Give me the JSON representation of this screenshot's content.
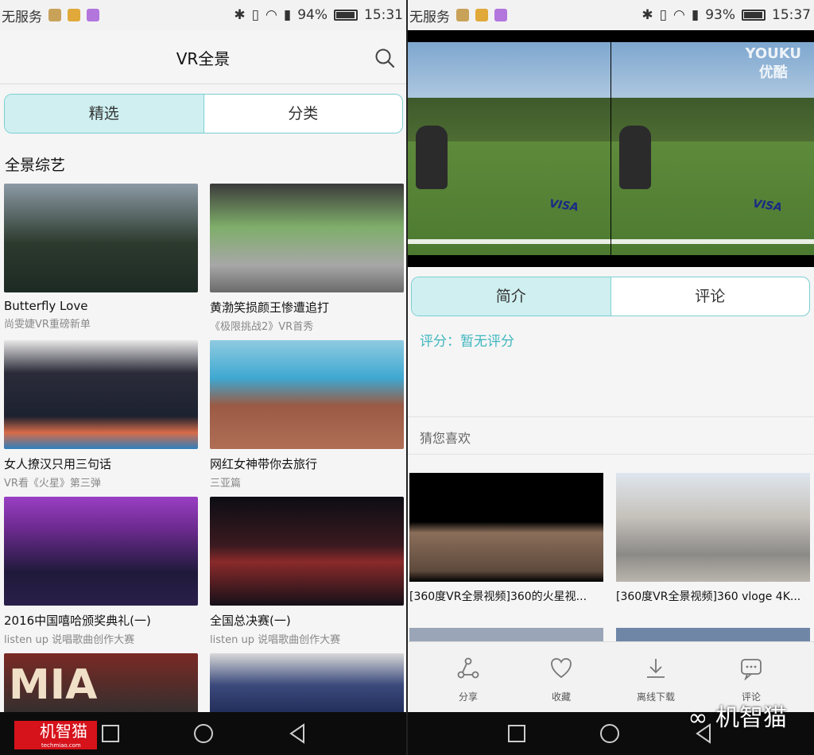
{
  "left_screen": {
    "status": {
      "carrier": "无服务",
      "battery": "94%",
      "time": "15:31"
    },
    "header": {
      "title": "VR全景"
    },
    "tabs": [
      {
        "label": "精选",
        "active": true
      },
      {
        "label": "分类",
        "active": false
      }
    ],
    "section_title": "全景综艺",
    "cards": [
      {
        "title": "Butterfly Love",
        "subtitle": "尚雯婕VR重磅新单"
      },
      {
        "title": "黄渤笑损颜王惨遭追打",
        "subtitle": "《极限挑战2》VR首秀"
      },
      {
        "title": "女人撩汉只用三句话",
        "subtitle": "VR看《火星》第三弹"
      },
      {
        "title": "网红女神带你去旅行",
        "subtitle": "三亚篇"
      },
      {
        "title": "2016中国嘻哈颁奖典礼(一)",
        "subtitle": "listen up 说唱歌曲创作大赛"
      },
      {
        "title": "全国总决赛(一)",
        "subtitle": "listen up 说唱歌曲创作大赛"
      }
    ],
    "partial_card_text": "MIA"
  },
  "right_screen": {
    "status": {
      "carrier": "无服务",
      "battery": "93%",
      "time": "15:37"
    },
    "video": {
      "watermark_line1": "YOUKU",
      "watermark_line2": "优酷",
      "sponsor": "VISA"
    },
    "tabs": [
      {
        "label": "简介",
        "active": true
      },
      {
        "label": "评论",
        "active": false
      }
    ],
    "rating": "评分：暂无评分",
    "recommend_header": "猜您喜欢",
    "recommendations": [
      {
        "title": "[360度VR全景视频]360的火星视..."
      },
      {
        "title": "[360度VR全景视频]360 vloge 4K..."
      }
    ],
    "actions": [
      {
        "label": "分享",
        "icon": "share-icon"
      },
      {
        "label": "收藏",
        "icon": "heart-icon"
      },
      {
        "label": "离线下载",
        "icon": "download-icon"
      },
      {
        "label": "评论",
        "icon": "comment-icon"
      }
    ]
  },
  "overlay": {
    "left_logo": "机智猫",
    "left_logo_url": "techmiao.com",
    "right_logo": "机智猫"
  },
  "colors": {
    "accent": "#3fb7c0",
    "tab_active_bg": "#cfeff0",
    "tab_border": "#7ccfd2",
    "logo_red": "#d6121b"
  }
}
